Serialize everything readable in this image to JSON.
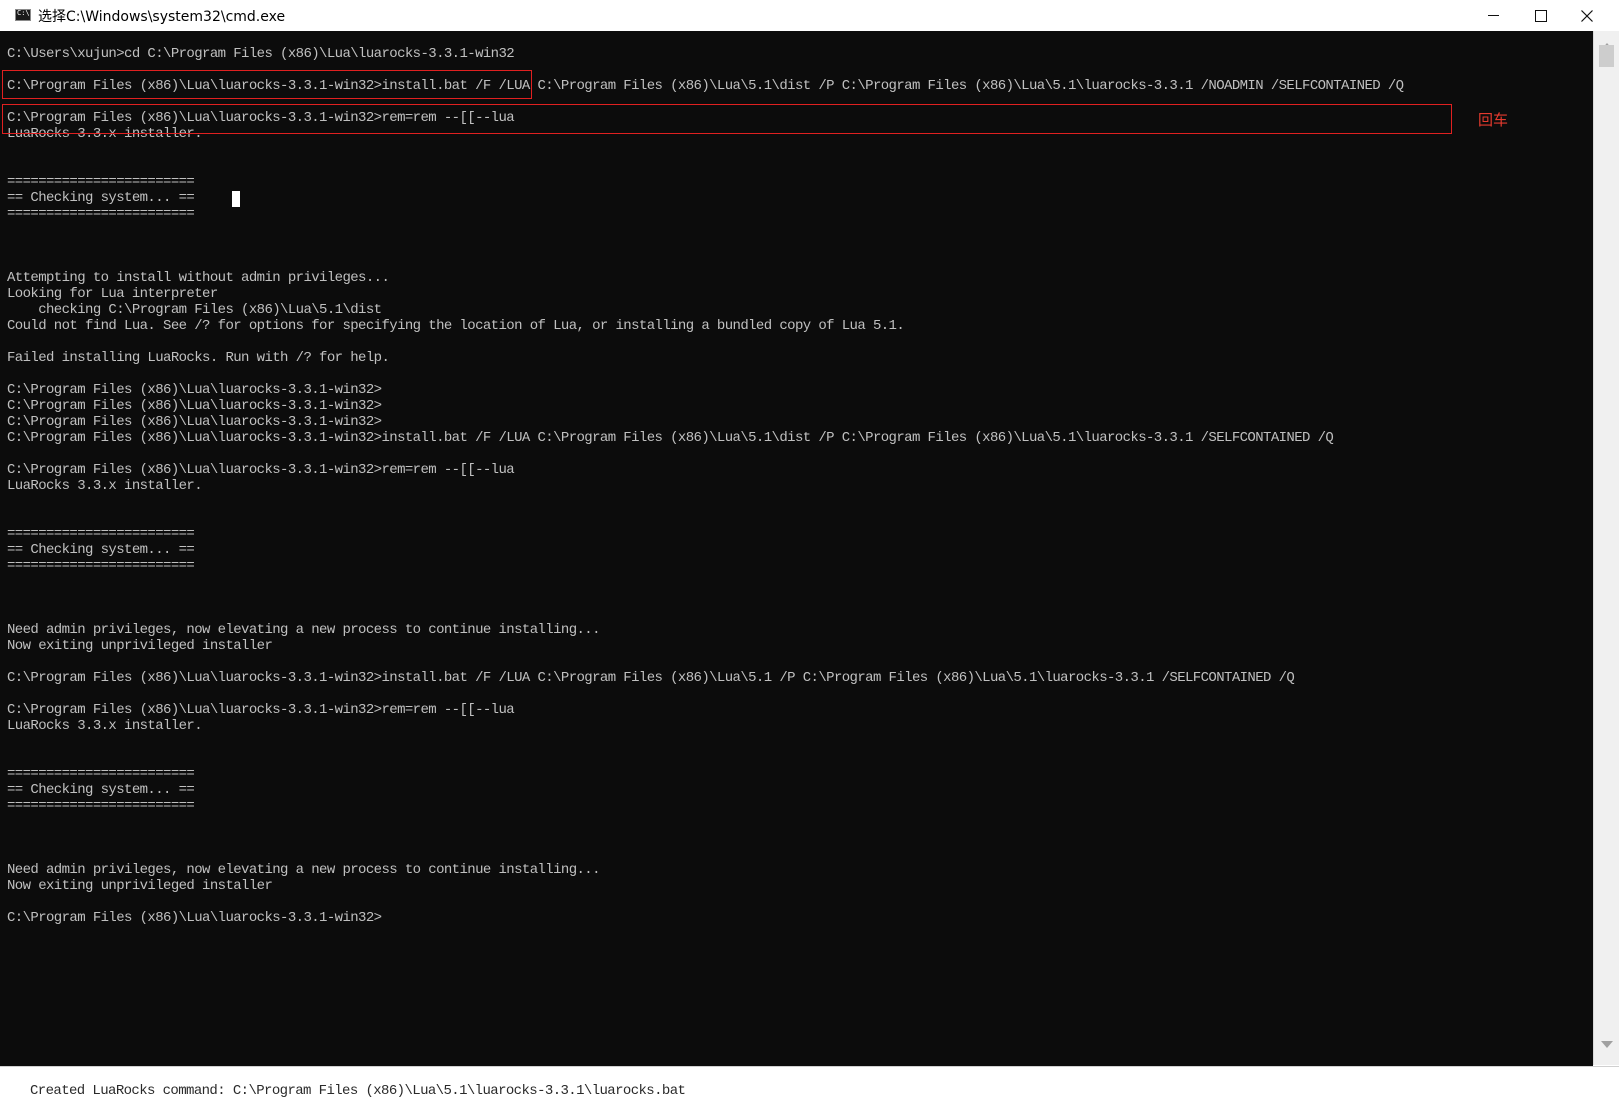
{
  "window": {
    "title": "选择C:\\Windows\\system32\\cmd.exe"
  },
  "annotation": {
    "label": "回车"
  },
  "console": {
    "lines": [
      "C:\\Users\\xujun>cd C:\\Program Files (x86)\\Lua\\luarocks-3.3.1-win32",
      "",
      "C:\\Program Files (x86)\\Lua\\luarocks-3.3.1-win32>install.bat /F /LUA C:\\Program Files (x86)\\Lua\\5.1\\dist /P C:\\Program Files (x86)\\Lua\\5.1\\luarocks-3.3.1 /NOADMIN /SELFCONTAINED /Q",
      "",
      "C:\\Program Files (x86)\\Lua\\luarocks-3.3.1-win32>rem=rem --[[--lua",
      "LuaRocks 3.3.x installer.",
      "",
      "",
      "========================",
      "== Checking system... ==",
      "========================",
      "",
      "",
      "",
      "Attempting to install without admin privileges...",
      "Looking for Lua interpreter",
      "    checking C:\\Program Files (x86)\\Lua\\5.1\\dist",
      "Could not find Lua. See /? for options for specifying the location of Lua, or installing a bundled copy of Lua 5.1.",
      "",
      "Failed installing LuaRocks. Run with /? for help.",
      "",
      "C:\\Program Files (x86)\\Lua\\luarocks-3.3.1-win32>",
      "C:\\Program Files (x86)\\Lua\\luarocks-3.3.1-win32>",
      "C:\\Program Files (x86)\\Lua\\luarocks-3.3.1-win32>",
      "C:\\Program Files (x86)\\Lua\\luarocks-3.3.1-win32>install.bat /F /LUA C:\\Program Files (x86)\\Lua\\5.1\\dist /P C:\\Program Files (x86)\\Lua\\5.1\\luarocks-3.3.1 /SELFCONTAINED /Q",
      "",
      "C:\\Program Files (x86)\\Lua\\luarocks-3.3.1-win32>rem=rem --[[--lua",
      "LuaRocks 3.3.x installer.",
      "",
      "",
      "========================",
      "== Checking system... ==",
      "========================",
      "",
      "",
      "",
      "Need admin privileges, now elevating a new process to continue installing...",
      "Now exiting unprivileged installer",
      "",
      "C:\\Program Files (x86)\\Lua\\luarocks-3.3.1-win32>install.bat /F /LUA C:\\Program Files (x86)\\Lua\\5.1 /P C:\\Program Files (x86)\\Lua\\5.1\\luarocks-3.3.1 /SELFCONTAINED /Q",
      "",
      "C:\\Program Files (x86)\\Lua\\luarocks-3.3.1-win32>rem=rem --[[--lua",
      "LuaRocks 3.3.x installer.",
      "",
      "",
      "========================",
      "== Checking system... ==",
      "========================",
      "",
      "",
      "",
      "Need admin privileges, now elevating a new process to continue installing...",
      "Now exiting unprivileged installer",
      "",
      "C:\\Program Files (x86)\\Lua\\luarocks-3.3.1-win32>"
    ]
  },
  "background_window": {
    "text": "Created LuaRocks command: C:\\Program Files (x86)\\Lua\\5.1\\luarocks-3.3.1\\luarocks.bat"
  }
}
